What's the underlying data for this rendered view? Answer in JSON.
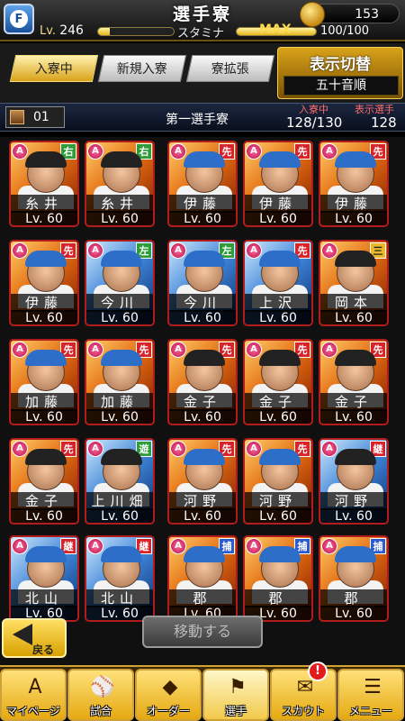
{
  "header": {
    "title": "選手寮",
    "level_prefix": "Lv.",
    "level": "246",
    "stamina_label": "スタミナ",
    "stamina_max_label": "MAX",
    "stamina": "100/100",
    "coins": "153",
    "team_logo_letter": "F"
  },
  "tabs": [
    {
      "label": "入寮中",
      "active": true
    },
    {
      "label": "新規入寮",
      "active": false
    },
    {
      "label": "寮拡張",
      "active": false
    }
  ],
  "sort": {
    "title": "表示切替",
    "value": "五十音順"
  },
  "dorm": {
    "number": "01",
    "name": "第一選手寮",
    "in_dorm_label": "入寮中",
    "shown_label": "表示選手",
    "in_dorm_count": "128/130",
    "shown_count": "128"
  },
  "players": [
    {
      "name": "糸井",
      "pos": "右",
      "pos_class": "p-right",
      "lv": "Lv. 60",
      "theme": "orange",
      "cap": "black"
    },
    {
      "name": "糸井",
      "pos": "右",
      "pos_class": "p-right",
      "lv": "Lv. 60",
      "theme": "orange",
      "cap": "black"
    },
    {
      "name": "伊藤",
      "pos": "先",
      "pos_class": "p-sen",
      "lv": "Lv. 60",
      "theme": "orange",
      "cap": "blue"
    },
    {
      "name": "伊藤",
      "pos": "先",
      "pos_class": "p-sen",
      "lv": "Lv. 60",
      "theme": "orange",
      "cap": "blue"
    },
    {
      "name": "伊藤",
      "pos": "先",
      "pos_class": "p-sen",
      "lv": "Lv. 60",
      "theme": "orange",
      "cap": "blue"
    },
    {
      "name": "伊藤",
      "pos": "先",
      "pos_class": "p-sen",
      "lv": "Lv. 60",
      "theme": "orange",
      "cap": "blue"
    },
    {
      "name": "今川",
      "pos": "左",
      "pos_class": "p-left",
      "lv": "Lv. 60",
      "theme": "blue",
      "cap": "blue"
    },
    {
      "name": "今川",
      "pos": "左",
      "pos_class": "p-left",
      "lv": "Lv. 60",
      "theme": "blue",
      "cap": "blue"
    },
    {
      "name": "上沢",
      "pos": "先",
      "pos_class": "p-sen",
      "lv": "Lv. 60",
      "theme": "blue",
      "cap": "blue"
    },
    {
      "name": "岡本",
      "pos": "三",
      "pos_class": "p-third",
      "lv": "Lv. 60",
      "theme": "orange",
      "cap": "black"
    },
    {
      "name": "加藤",
      "pos": "先",
      "pos_class": "p-sen",
      "lv": "Lv. 60",
      "theme": "orange",
      "cap": "blue"
    },
    {
      "name": "加藤",
      "pos": "先",
      "pos_class": "p-sen",
      "lv": "Lv. 60",
      "theme": "orange",
      "cap": "blue"
    },
    {
      "name": "金子",
      "pos": "先",
      "pos_class": "p-sen",
      "lv": "Lv. 60",
      "theme": "orange",
      "cap": "black"
    },
    {
      "name": "金子",
      "pos": "先",
      "pos_class": "p-sen",
      "lv": "Lv. 60",
      "theme": "orange",
      "cap": "black"
    },
    {
      "name": "金子",
      "pos": "先",
      "pos_class": "p-sen",
      "lv": "Lv. 60",
      "theme": "orange",
      "cap": "black"
    },
    {
      "name": "金子",
      "pos": "先",
      "pos_class": "p-sen",
      "lv": "Lv. 60",
      "theme": "orange",
      "cap": "black"
    },
    {
      "name": "上川畑",
      "pos": "遊",
      "pos_class": "p-yu",
      "lv": "Lv. 60",
      "theme": "blue",
      "cap": "black"
    },
    {
      "name": "河野",
      "pos": "先",
      "pos_class": "p-sen",
      "lv": "Lv. 60",
      "theme": "orange",
      "cap": "blue"
    },
    {
      "name": "河野",
      "pos": "先",
      "pos_class": "p-sen",
      "lv": "Lv. 60",
      "theme": "orange",
      "cap": "blue"
    },
    {
      "name": "河野",
      "pos": "継",
      "pos_class": "p-kei",
      "lv": "Lv. 60",
      "theme": "blue",
      "cap": "black"
    },
    {
      "name": "北山",
      "pos": "継",
      "pos_class": "p-kei",
      "lv": "Lv. 60",
      "theme": "blue",
      "cap": "blue"
    },
    {
      "name": "北山",
      "pos": "継",
      "pos_class": "p-kei",
      "lv": "Lv. 60",
      "theme": "blue",
      "cap": "blue"
    },
    {
      "name": "郡",
      "pos": "捕",
      "pos_class": "p-ho",
      "lv": "Lv. 60",
      "theme": "orange",
      "cap": "blue"
    },
    {
      "name": "郡",
      "pos": "捕",
      "pos_class": "p-ho",
      "lv": "Lv. 60",
      "theme": "orange",
      "cap": "blue"
    },
    {
      "name": "郡",
      "pos": "捕",
      "pos_class": "p-ho",
      "lv": "Lv. 60",
      "theme": "orange",
      "cap": "blue"
    }
  ],
  "rank_letter": "A",
  "bottom": {
    "back_label": "戻る",
    "move_label": "移動する"
  },
  "nav": [
    {
      "label": "マイページ",
      "icon": "A",
      "active": false
    },
    {
      "label": "試合",
      "icon": "⚾",
      "active": false
    },
    {
      "label": "オーダー",
      "icon": "◆",
      "active": false
    },
    {
      "label": "選手",
      "icon": "⚑",
      "active": true
    },
    {
      "label": "スカウト",
      "icon": "✉",
      "active": false
    },
    {
      "label": "メニュー",
      "icon": "☰",
      "active": false
    }
  ],
  "scout_badge": "!"
}
